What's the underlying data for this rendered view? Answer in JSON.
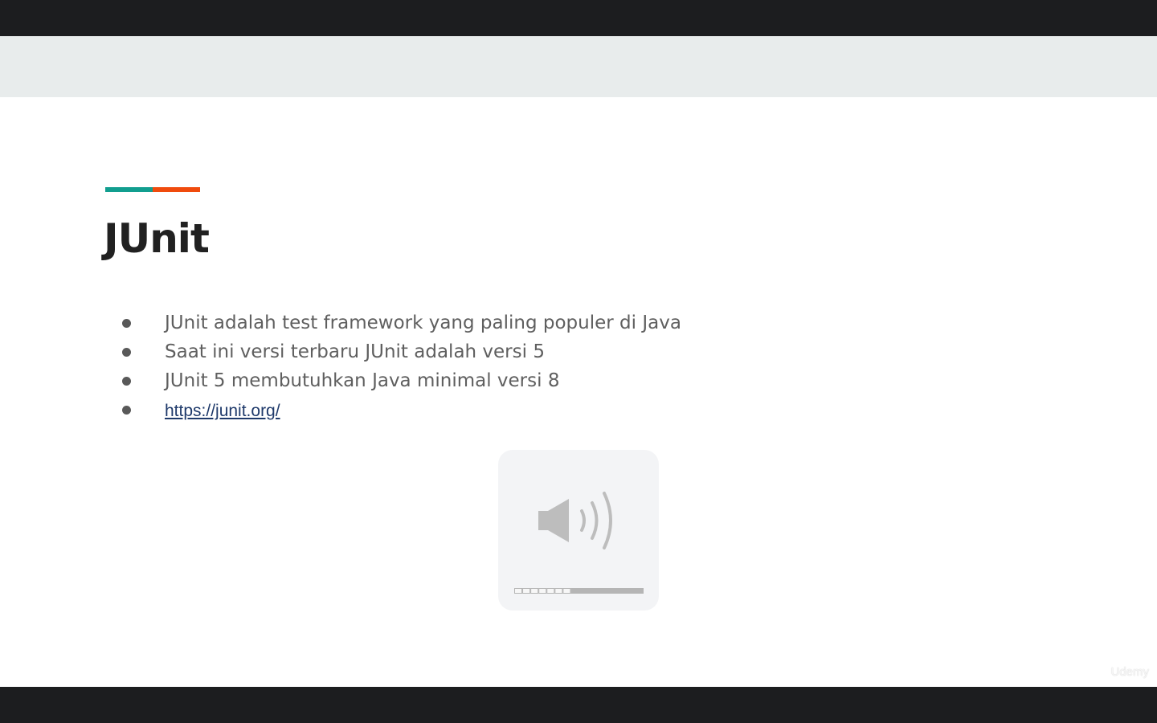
{
  "slide": {
    "title": "JUnit",
    "accent_colors": {
      "teal": "#119e8f",
      "orange": "#f04b0d"
    },
    "bullets": [
      "JUnit adalah test framework yang paling populer di Java",
      "Saat ini versi terbaru JUnit adalah versi 5",
      "JUnit 5 membutuhkan Java minimal versi 8"
    ],
    "link": "https://junit.org/"
  },
  "volume_overlay": {
    "icon": "speaker-volume-icon",
    "level_fraction": 0.5625,
    "segments_total": 16
  },
  "watermark": "Udemy"
}
